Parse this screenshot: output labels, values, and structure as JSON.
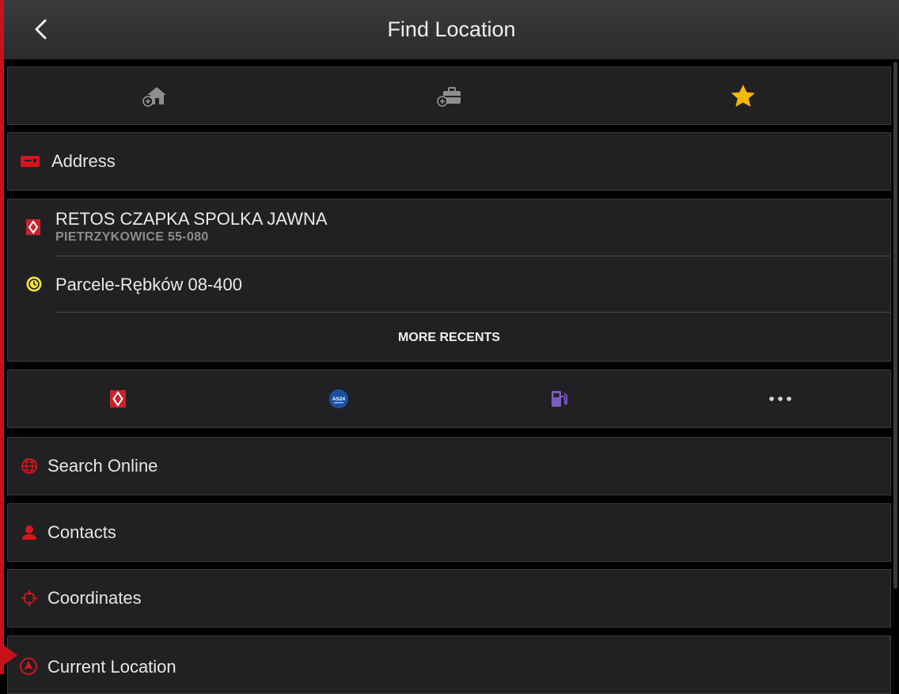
{
  "header": {
    "title": "Find Location",
    "back_icon": "chevron-left-icon"
  },
  "quick_bar": {
    "items": [
      {
        "icon": "home-add-icon"
      },
      {
        "icon": "work-add-icon"
      },
      {
        "icon": "star-icon",
        "color": "#f5b90a"
      }
    ]
  },
  "address": {
    "label": "Address",
    "icon": "address-card-icon",
    "color": "#d8141e"
  },
  "recents": {
    "items": [
      {
        "icon": "renault-logo-icon",
        "title": "RETOS CZAPKA SPOLKA JAWNA",
        "subtitle": "PIETRZYKOWICE 55-080"
      },
      {
        "icon": "history-clock-icon",
        "title": "Parcele-Rębków 08-400",
        "subtitle": ""
      }
    ],
    "more_label": "MORE RECENTS"
  },
  "categories": {
    "items": [
      {
        "icon": "renault-logo-icon"
      },
      {
        "icon": "as24-logo-icon",
        "text": "AS24"
      },
      {
        "icon": "fuel-station-icon",
        "color": "#7a5cc8"
      },
      {
        "icon": "more-dots-icon"
      }
    ]
  },
  "menu": {
    "items": [
      {
        "label": "Search Online",
        "icon": "globe-icon"
      },
      {
        "label": "Contacts",
        "icon": "person-icon"
      },
      {
        "label": "Coordinates",
        "icon": "crosshair-icon"
      },
      {
        "label": "Current Location",
        "icon": "location-arrow-icon"
      }
    ]
  }
}
